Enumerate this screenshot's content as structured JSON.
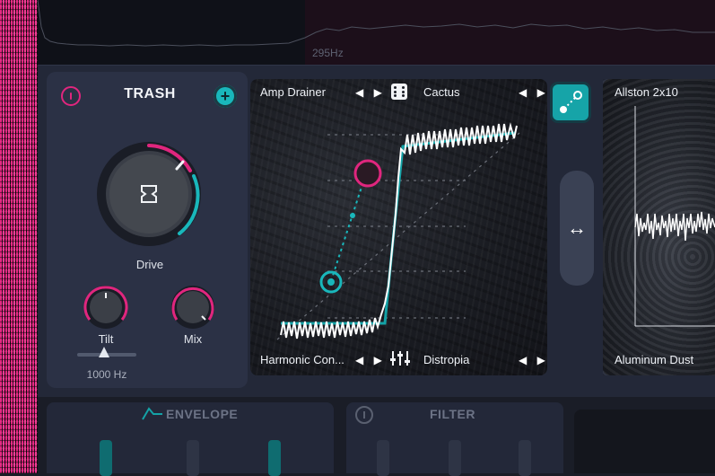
{
  "spectrum": {
    "freq_label": "295Hz"
  },
  "module": {
    "title": "TRASH",
    "drive": {
      "label": "Drive"
    },
    "tilt": {
      "label": "Tilt",
      "freq": "1000 Hz"
    },
    "mix": {
      "label": "Mix"
    }
  },
  "shaper": {
    "top_left": "Amp Drainer",
    "top_right": "Cactus",
    "bottom_left": "Harmonic Con...",
    "bottom_right": "Distropia",
    "arrows": "◀ ▶"
  },
  "right_display": {
    "top": "Allston 2x10",
    "bottom": "Aluminum Dust"
  },
  "bottom": {
    "envelope": "ENVELOPE",
    "filter": "FILTER"
  },
  "colors": {
    "accent_pink": "#e0267e",
    "accent_teal": "#19b7bb",
    "panel": "#2b3145"
  },
  "icons": [
    "power-icon",
    "add-icon",
    "dice-icon",
    "mixer-icon",
    "link-icon",
    "swap-icon",
    "envelope-icon"
  ]
}
